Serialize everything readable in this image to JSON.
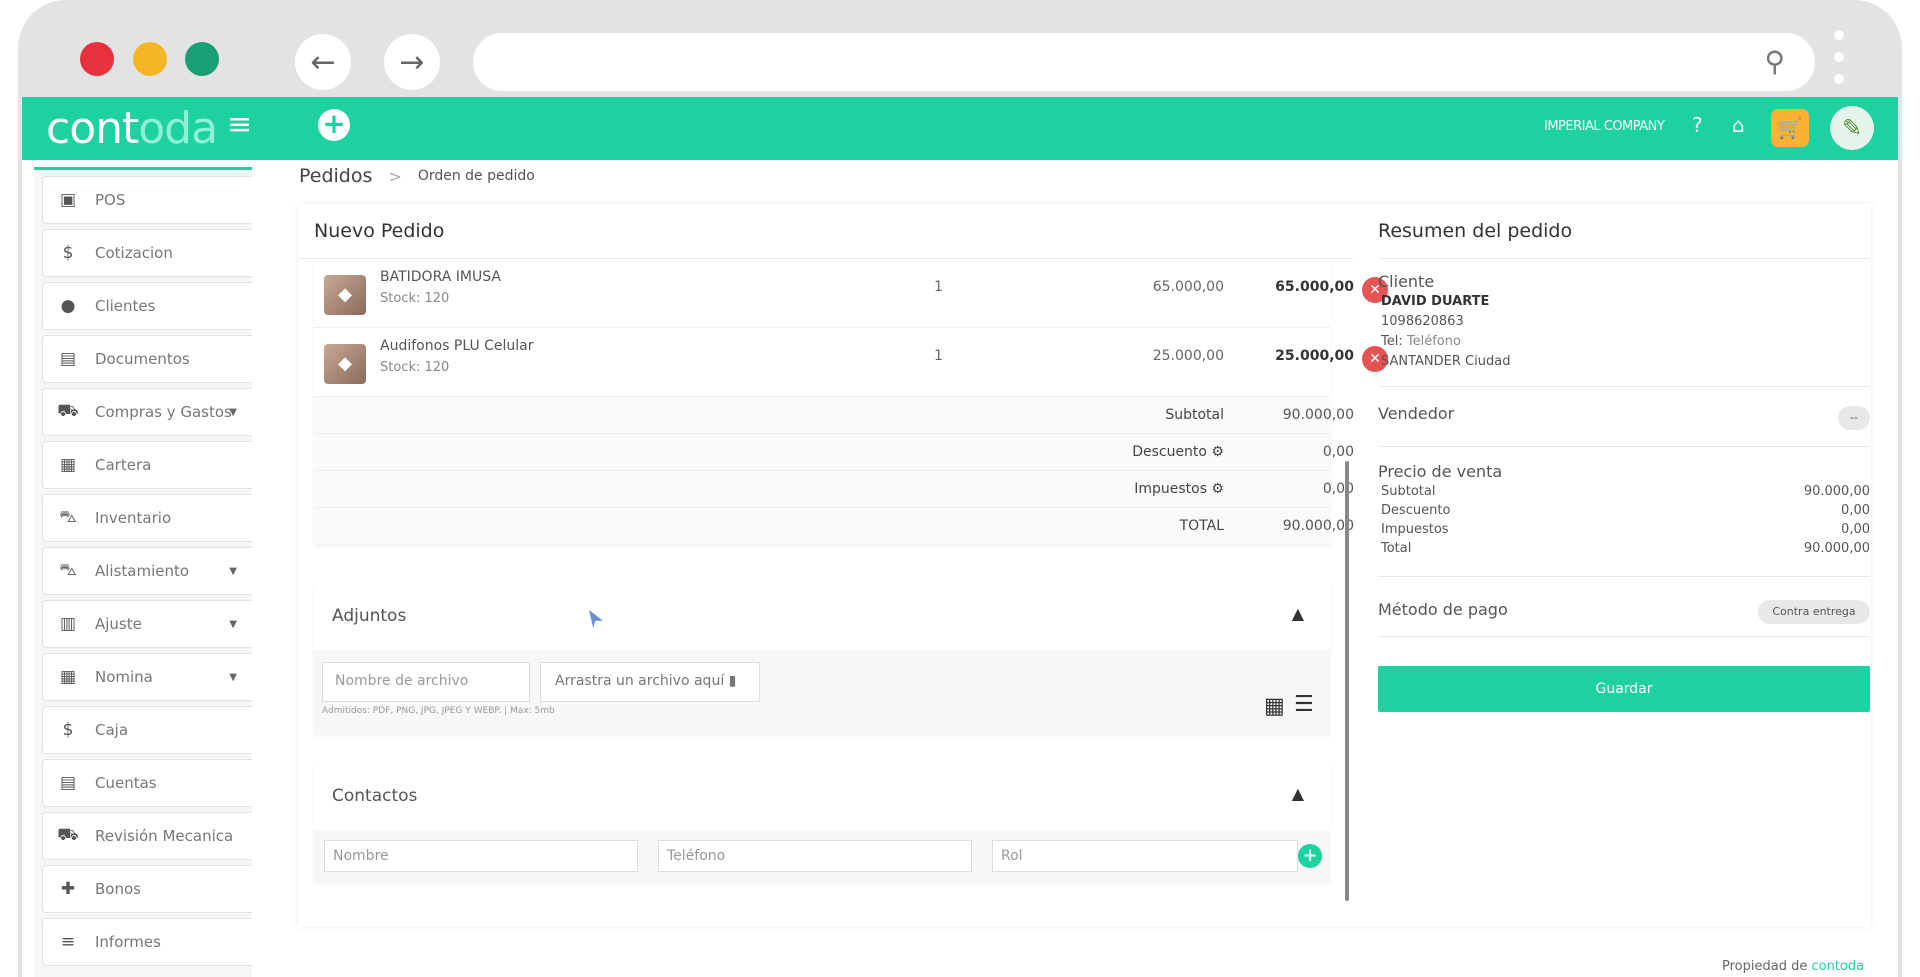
{
  "browser": {
    "dots": [
      "#e8313f",
      "#f5b625",
      "#1a9e76"
    ],
    "back_icon": "arrow-left-icon",
    "forward_icon": "arrow-right-icon",
    "search_icon": "search-icon"
  },
  "topbar": {
    "logo_dark": "cont",
    "logo_light": "oda",
    "company": "IMPERIAL COMPANY",
    "accent": "#1dd1a1"
  },
  "sidebar": {
    "items": [
      {
        "label": "POS",
        "icon": "money-icon"
      },
      {
        "label": "Cotizacion",
        "icon": "dollar-icon"
      },
      {
        "label": "Clientes",
        "icon": "user-icon"
      },
      {
        "label": "Documentos",
        "icon": "document-icon"
      },
      {
        "label": "Compras y Gastos",
        "icon": "cart-icon",
        "caret": true
      },
      {
        "label": "Cartera",
        "icon": "wallet-icon"
      },
      {
        "label": "Inventario",
        "icon": "car-icon"
      },
      {
        "label": "Alistamiento",
        "icon": "car-icon",
        "caret": true
      },
      {
        "label": "Ajuste",
        "icon": "calculator-icon",
        "caret": true
      },
      {
        "label": "Nomina",
        "icon": "id-card-icon",
        "caret": true
      },
      {
        "label": "Caja",
        "icon": "hand-money-icon"
      },
      {
        "label": "Cuentas",
        "icon": "file-icon"
      },
      {
        "label": "Revisión Mecanica",
        "icon": "bus-icon"
      },
      {
        "label": "Bonos",
        "icon": "gift-icon"
      },
      {
        "label": "Informes",
        "icon": "list-icon"
      }
    ]
  },
  "breadcrumb": {
    "main": "Pedidos",
    "sep": ">",
    "sub": "Orden de pedido"
  },
  "order": {
    "title": "Nuevo Pedido",
    "items": [
      {
        "name": "BATIDORA IMUSA",
        "stock": "Stock: 120",
        "qty": "1",
        "price": "65.000,00",
        "total": "65.000,00"
      },
      {
        "name": "Audifonos PLU Celular",
        "stock": "Stock: 120",
        "qty": "1",
        "price": "25.000,00",
        "total": "25.000,00"
      }
    ],
    "summary_rows": [
      {
        "label": "Subtotal",
        "value": "90.000,00"
      },
      {
        "label": "Descuento ⚙",
        "value": "0,00"
      },
      {
        "label": "Impuestos ⚙",
        "value": "0,00"
      },
      {
        "label": "TOTAL",
        "value": "90.000,00"
      }
    ]
  },
  "attachments": {
    "title": "Adjuntos",
    "filename_placeholder": "Nombre de archivo",
    "drop_label": "Arrastra un archivo aquí",
    "allowed": "Admitidos: PDF, PNG, JPG, JPEG Y WEBP. | Max: 5mb"
  },
  "contacts": {
    "title": "Contactos",
    "name_placeholder": "Nombre",
    "phone_placeholder": "Teléfono",
    "role_placeholder": "Rol"
  },
  "summary": {
    "title": "Resumen del pedido",
    "client_label": "Cliente",
    "client_name": "DAVID DUARTE",
    "client_id": "1098620863",
    "client_tel_prefix": "Tel:",
    "client_tel": "Teléfono",
    "client_city": "SANTANDER Ciudad",
    "seller_label": "Vendedor",
    "seller_value": "--",
    "price_label": "Precio de venta",
    "price_rows": [
      {
        "label": "Subtotal",
        "value": "90.000,00"
      },
      {
        "label": "Descuento",
        "value": "0,00"
      },
      {
        "label": "Impuestos",
        "value": "0,00"
      },
      {
        "label": "Total",
        "value": "90.000,00"
      }
    ],
    "payment_label": "Método de pago",
    "payment_value": "Contra entrega",
    "save_label": "Guardar"
  },
  "footer": {
    "prefix": "Propiedad de",
    "brand": "contoda"
  }
}
